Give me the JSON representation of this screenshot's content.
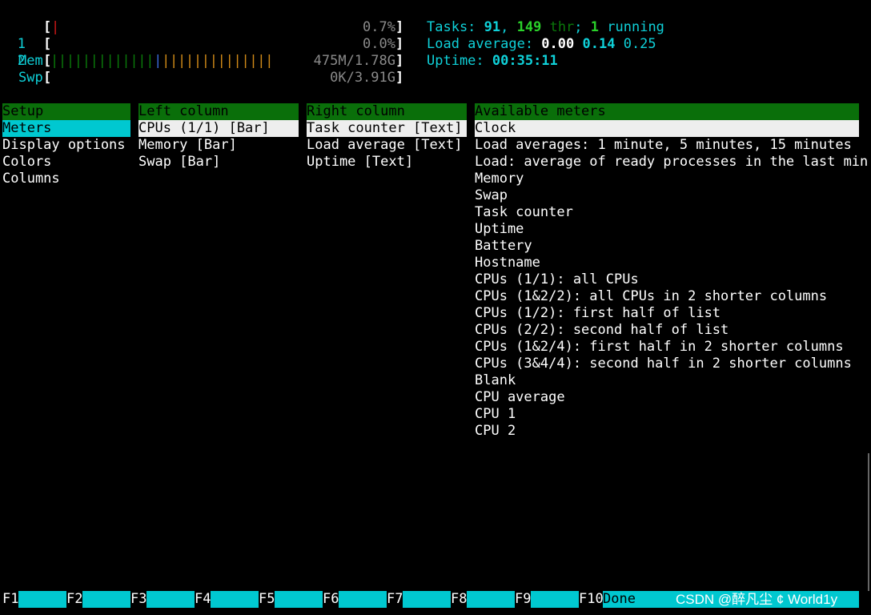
{
  "meters_left": {
    "cpu1": {
      "label": "1",
      "percent_text": "0.7%",
      "usage_percent": 0.7
    },
    "cpu2": {
      "label": "2",
      "percent_text": "0.0%",
      "usage_percent": 0.0
    },
    "mem": {
      "label": "Mem",
      "value_text": "475M/1.78G",
      "ticks_used": 13,
      "ticks_buffers": 1,
      "ticks_cache": 14
    },
    "swp": {
      "label": "Swp",
      "value_text": "0K/3.91G"
    }
  },
  "meters_right": {
    "tasks": {
      "label": "Tasks: ",
      "tasks": "91",
      "sep": ", ",
      "threads": "149",
      "thr_label": " thr",
      "semi": "; ",
      "running": "1",
      "running_label": " running"
    },
    "load": {
      "label": "Load average: ",
      "v1": "0.00",
      "v5": "0.14",
      "v15": "0.25"
    },
    "uptime": {
      "label": "Uptime: ",
      "value": "00:35:11"
    }
  },
  "setup": {
    "header": "Setup",
    "items": [
      "Meters",
      "Display options",
      "Colors",
      "Columns"
    ]
  },
  "left_column": {
    "header": "Left column",
    "items": [
      "CPUs (1/1) [Bar]",
      "Memory [Bar]",
      "Swap [Bar]"
    ]
  },
  "right_column": {
    "header": "Right column",
    "items": [
      "Task counter [Text]",
      "Load average [Text]",
      "Uptime [Text]"
    ]
  },
  "available_meters": {
    "header": "Available meters",
    "items": [
      "Clock",
      "Load averages: 1 minute, 5 minutes, 15 minutes",
      "Load: average of ready processes in the last min",
      "Memory",
      "Swap",
      "Task counter",
      "Uptime",
      "Battery",
      "Hostname",
      "CPUs (1/1): all CPUs",
      "CPUs (1&2/2): all CPUs in 2 shorter columns",
      "CPUs (1/2): first half of list",
      "CPUs (2/2): second half of list",
      "CPUs (1&2/4): first half in 2 shorter columns",
      "CPUs (3&4/4): second half in 2 shorter columns",
      "Blank",
      "CPU average",
      "CPU 1",
      "CPU 2"
    ]
  },
  "function_keys": [
    {
      "key": "F1",
      "label": ""
    },
    {
      "key": "F2",
      "label": ""
    },
    {
      "key": "F3",
      "label": ""
    },
    {
      "key": "F4",
      "label": ""
    },
    {
      "key": "F5",
      "label": ""
    },
    {
      "key": "F6",
      "label": ""
    },
    {
      "key": "F7",
      "label": ""
    },
    {
      "key": "F8",
      "label": ""
    },
    {
      "key": "F9",
      "label": ""
    },
    {
      "key": "F10",
      "label": "Done"
    }
  ],
  "watermark": "CSDN @醉凡尘 ¢ World1y",
  "colors": {
    "accent_cyan": "#00c8d0",
    "header_green": "#0a6f0a",
    "selected_white": "#eeeeee"
  }
}
